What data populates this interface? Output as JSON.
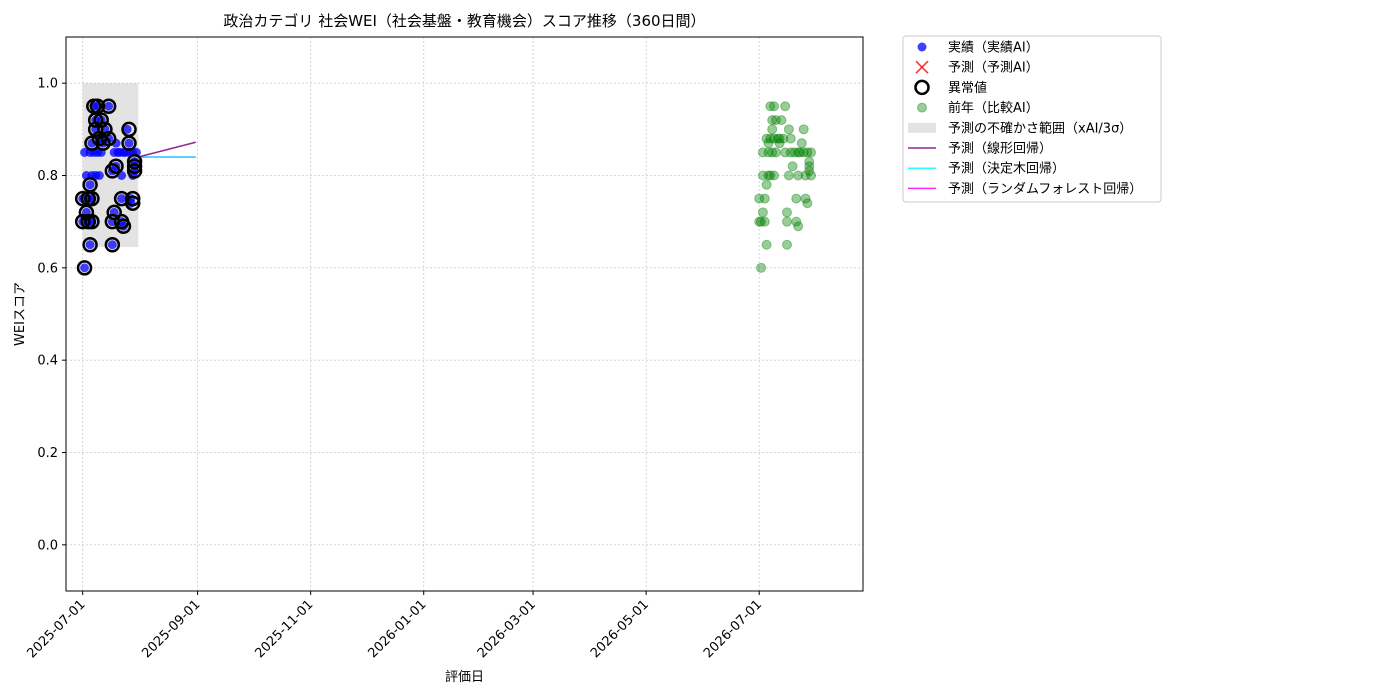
{
  "chart_data": {
    "type": "scatter",
    "title": "政治カテゴリ 社会WEI（社会基盤・教育機会）スコア推移（360日間）",
    "xlabel": "評価日",
    "ylabel": "WEIスコア",
    "xlim": [
      "2025-06-22",
      "2026-08-26"
    ],
    "ylim": [
      -0.1,
      1.1
    ],
    "grid": true,
    "legend_position": "outside-top-right",
    "x_ticks": [
      "2025-07-01",
      "2025-09-01",
      "2025-11-01",
      "2026-01-01",
      "2026-03-01",
      "2026-05-01",
      "2026-07-01"
    ],
    "y_ticks": [
      "0.0",
      "0.2",
      "0.4",
      "0.6",
      "0.8",
      "1.0"
    ],
    "legend": [
      {
        "key": "actual",
        "label": "実績（実績AI）"
      },
      {
        "key": "forecast",
        "label": "予測（予測AI）"
      },
      {
        "key": "anomaly",
        "label": "異常値"
      },
      {
        "key": "prev_year",
        "label": "前年（比較AI）"
      },
      {
        "key": "uncertainty",
        "label": "予測の不確かさ範囲（xAI/3σ）"
      },
      {
        "key": "linear",
        "label": "予測（線形回帰）"
      },
      {
        "key": "tree",
        "label": "予測（決定木回帰）"
      },
      {
        "key": "forest",
        "label": "予測（ランダムフォレスト回帰）"
      }
    ],
    "colors": {
      "actual": "#0000ff",
      "forecast": "#ff0000",
      "anomaly": "#000000",
      "prev_year": "#008000",
      "uncertainty": "#cccccc",
      "linear": "#800080",
      "tree": "#00ffff",
      "forest": "#ff00ff"
    },
    "uncertainty_band": {
      "x": [
        "2025-07-01",
        "2025-07-31"
      ],
      "y": [
        0.645,
        1.0
      ]
    },
    "series": [
      {
        "key": "actual",
        "points": [
          [
            "2025-07-01",
            0.7
          ],
          [
            "2025-07-01",
            0.75
          ],
          [
            "2025-07-02",
            0.6
          ],
          [
            "2025-07-02",
            0.85
          ],
          [
            "2025-07-03",
            0.72
          ],
          [
            "2025-07-03",
            0.8
          ],
          [
            "2025-07-04",
            0.7
          ],
          [
            "2025-07-04",
            0.75
          ],
          [
            "2025-07-05",
            0.65
          ],
          [
            "2025-07-05",
            0.78
          ],
          [
            "2025-07-05",
            0.85
          ],
          [
            "2025-07-06",
            0.7
          ],
          [
            "2025-07-06",
            0.75
          ],
          [
            "2025-07-06",
            0.8
          ],
          [
            "2025-07-06",
            0.87
          ],
          [
            "2025-07-07",
            0.95
          ],
          [
            "2025-07-07",
            0.85
          ],
          [
            "2025-07-08",
            0.92
          ],
          [
            "2025-07-08",
            0.9
          ],
          [
            "2025-07-08",
            0.8
          ],
          [
            "2025-07-09",
            0.95
          ],
          [
            "2025-07-09",
            0.85
          ],
          [
            "2025-07-10",
            0.88
          ],
          [
            "2025-07-10",
            0.8
          ],
          [
            "2025-07-11",
            0.92
          ],
          [
            "2025-07-11",
            0.85
          ],
          [
            "2025-07-12",
            0.87
          ],
          [
            "2025-07-13",
            0.9
          ],
          [
            "2025-07-15",
            0.88
          ],
          [
            "2025-07-15",
            0.95
          ],
          [
            "2025-07-17",
            0.7
          ],
          [
            "2025-07-17",
            0.81
          ],
          [
            "2025-07-17",
            0.65
          ],
          [
            "2025-07-18",
            0.85
          ],
          [
            "2025-07-18",
            0.72
          ],
          [
            "2025-07-19",
            0.87
          ],
          [
            "2025-07-19",
            0.82
          ],
          [
            "2025-07-20",
            0.85
          ],
          [
            "2025-07-21",
            0.85
          ],
          [
            "2025-07-22",
            0.75
          ],
          [
            "2025-07-22",
            0.7
          ],
          [
            "2025-07-22",
            0.8
          ],
          [
            "2025-07-23",
            0.69
          ],
          [
            "2025-07-23",
            0.85
          ],
          [
            "2025-07-24",
            0.85
          ],
          [
            "2025-07-25",
            0.9
          ],
          [
            "2025-07-26",
            0.87
          ],
          [
            "2025-07-26",
            0.85
          ],
          [
            "2025-07-27",
            0.75
          ],
          [
            "2025-07-27",
            0.74
          ],
          [
            "2025-07-28",
            0.85
          ],
          [
            "2025-07-28",
            0.8
          ],
          [
            "2025-07-29",
            0.83
          ],
          [
            "2025-07-29",
            0.82
          ],
          [
            "2025-07-29",
            0.81
          ],
          [
            "2025-07-30",
            0.85
          ]
        ]
      },
      {
        "key": "anomaly",
        "points": [
          [
            "2025-07-01",
            0.7
          ],
          [
            "2025-07-01",
            0.75
          ],
          [
            "2025-07-02",
            0.6
          ],
          [
            "2025-07-03",
            0.72
          ],
          [
            "2025-07-04",
            0.7
          ],
          [
            "2025-07-04",
            0.75
          ],
          [
            "2025-07-05",
            0.65
          ],
          [
            "2025-07-05",
            0.78
          ],
          [
            "2025-07-06",
            0.7
          ],
          [
            "2025-07-06",
            0.75
          ],
          [
            "2025-07-06",
            0.87
          ],
          [
            "2025-07-07",
            0.95
          ],
          [
            "2025-07-08",
            0.92
          ],
          [
            "2025-07-08",
            0.9
          ],
          [
            "2025-07-09",
            0.95
          ],
          [
            "2025-07-10",
            0.88
          ],
          [
            "2025-07-11",
            0.92
          ],
          [
            "2025-07-12",
            0.87
          ],
          [
            "2025-07-13",
            0.9
          ],
          [
            "2025-07-15",
            0.88
          ],
          [
            "2025-07-15",
            0.95
          ],
          [
            "2025-07-17",
            0.7
          ],
          [
            "2025-07-17",
            0.81
          ],
          [
            "2025-07-17",
            0.65
          ],
          [
            "2025-07-18",
            0.72
          ],
          [
            "2025-07-19",
            0.82
          ],
          [
            "2025-07-22",
            0.75
          ],
          [
            "2025-07-22",
            0.7
          ],
          [
            "2025-07-23",
            0.69
          ],
          [
            "2025-07-26",
            0.9
          ],
          [
            "2025-07-26",
            0.87
          ],
          [
            "2025-07-28",
            0.75
          ],
          [
            "2025-07-28",
            0.74
          ],
          [
            "2025-07-29",
            0.83
          ],
          [
            "2025-07-29",
            0.82
          ],
          [
            "2025-07-29",
            0.81
          ]
        ]
      },
      {
        "key": "prev_year",
        "points": [
          [
            "2026-07-01",
            0.7
          ],
          [
            "2026-07-01",
            0.75
          ],
          [
            "2026-07-02",
            0.6
          ],
          [
            "2026-07-02",
            0.7
          ],
          [
            "2026-07-03",
            0.72
          ],
          [
            "2026-07-03",
            0.8
          ],
          [
            "2026-07-03",
            0.85
          ],
          [
            "2026-07-04",
            0.75
          ],
          [
            "2026-07-04",
            0.7
          ],
          [
            "2026-07-05",
            0.65
          ],
          [
            "2026-07-05",
            0.78
          ],
          [
            "2026-07-05",
            0.88
          ],
          [
            "2026-07-06",
            0.8
          ],
          [
            "2026-07-06",
            0.85
          ],
          [
            "2026-07-06",
            0.87
          ],
          [
            "2026-07-07",
            0.95
          ],
          [
            "2026-07-07",
            0.88
          ],
          [
            "2026-07-07",
            0.8
          ],
          [
            "2026-07-08",
            0.92
          ],
          [
            "2026-07-08",
            0.9
          ],
          [
            "2026-07-08",
            0.85
          ],
          [
            "2026-07-09",
            0.95
          ],
          [
            "2026-07-09",
            0.88
          ],
          [
            "2026-07-09",
            0.8
          ],
          [
            "2026-07-10",
            0.92
          ],
          [
            "2026-07-10",
            0.85
          ],
          [
            "2026-07-11",
            0.88
          ],
          [
            "2026-07-12",
            0.87
          ],
          [
            "2026-07-12",
            0.88
          ],
          [
            "2026-07-13",
            0.92
          ],
          [
            "2026-07-14",
            0.88
          ],
          [
            "2026-07-15",
            0.95
          ],
          [
            "2026-07-15",
            0.85
          ],
          [
            "2026-07-16",
            0.72
          ],
          [
            "2026-07-16",
            0.65
          ],
          [
            "2026-07-16",
            0.7
          ],
          [
            "2026-07-17",
            0.8
          ],
          [
            "2026-07-17",
            0.9
          ],
          [
            "2026-07-18",
            0.85
          ],
          [
            "2026-07-18",
            0.88
          ],
          [
            "2026-07-19",
            0.82
          ],
          [
            "2026-07-20",
            0.85
          ],
          [
            "2026-07-21",
            0.75
          ],
          [
            "2026-07-21",
            0.7
          ],
          [
            "2026-07-22",
            0.69
          ],
          [
            "2026-07-22",
            0.85
          ],
          [
            "2026-07-22",
            0.8
          ],
          [
            "2026-07-23",
            0.85
          ],
          [
            "2026-07-24",
            0.87
          ],
          [
            "2026-07-25",
            0.9
          ],
          [
            "2026-07-25",
            0.85
          ],
          [
            "2026-07-26",
            0.75
          ],
          [
            "2026-07-26",
            0.8
          ],
          [
            "2026-07-27",
            0.74
          ],
          [
            "2026-07-27",
            0.85
          ],
          [
            "2026-07-28",
            0.83
          ],
          [
            "2026-07-28",
            0.82
          ],
          [
            "2026-07-28",
            0.81
          ],
          [
            "2026-07-29",
            0.85
          ],
          [
            "2026-07-29",
            0.8
          ]
        ]
      },
      {
        "key": "linear",
        "points": [
          [
            "2025-07-31",
            0.84
          ],
          [
            "2025-08-31",
            0.872
          ]
        ]
      },
      {
        "key": "forest",
        "points": [
          [
            "2025-07-31",
            0.84
          ],
          [
            "2025-08-31",
            0.84
          ]
        ]
      },
      {
        "key": "tree",
        "points": [
          [
            "2025-07-31",
            0.84
          ],
          [
            "2025-08-31",
            0.84
          ]
        ]
      }
    ]
  }
}
